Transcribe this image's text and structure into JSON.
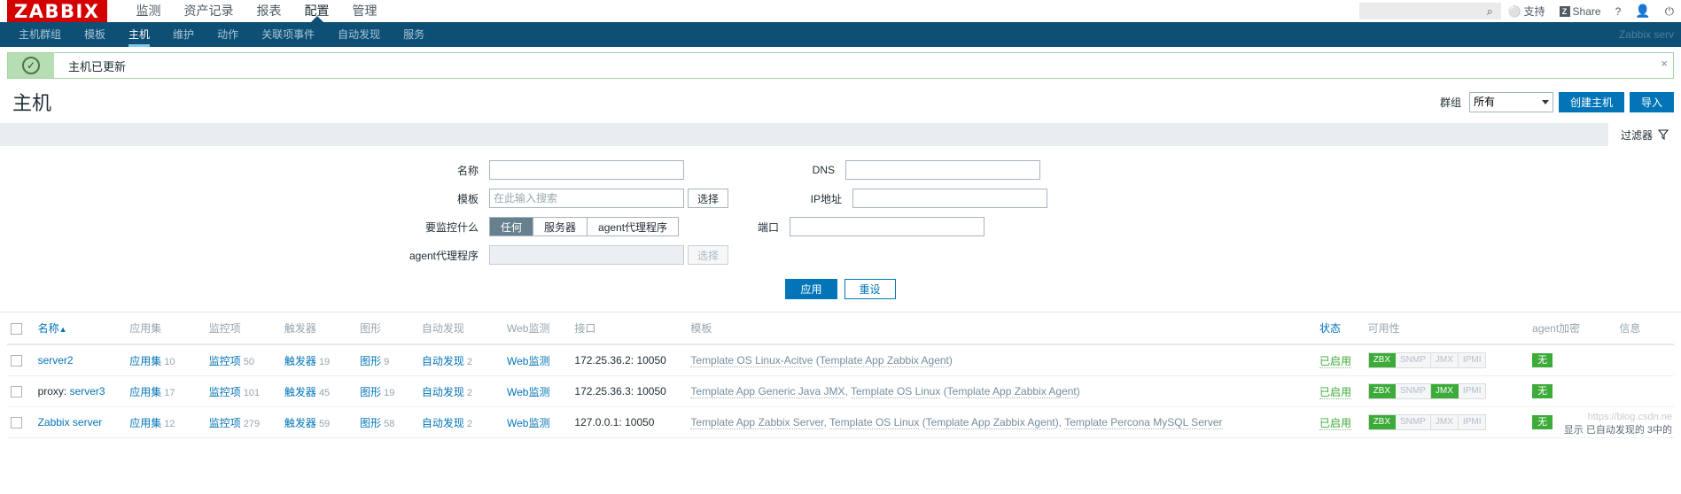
{
  "brand": {
    "logo": "ZABBIX"
  },
  "main_menu": [
    {
      "label": "监测",
      "selected": false
    },
    {
      "label": "资产记录",
      "selected": false
    },
    {
      "label": "报表",
      "selected": false
    },
    {
      "label": "配置",
      "selected": true
    },
    {
      "label": "管理",
      "selected": false
    }
  ],
  "top_right": {
    "search_placeholder": "",
    "search_value": "",
    "support_label": "支持",
    "share_label": "Share",
    "share_badge": "Z",
    "help_label": "?",
    "user_icon": "user-icon",
    "logout_icon": "power-icon"
  },
  "sub_menu": [
    {
      "label": "主机群组",
      "selected": false
    },
    {
      "label": "模板",
      "selected": false
    },
    {
      "label": "主机",
      "selected": true
    },
    {
      "label": "维护",
      "selected": false
    },
    {
      "label": "动作",
      "selected": false
    },
    {
      "label": "关联项事件",
      "selected": false
    },
    {
      "label": "自动发现",
      "selected": false
    },
    {
      "label": "服务",
      "selected": false
    }
  ],
  "server_name": "Zabbix serv",
  "message": {
    "text": "主机已更新",
    "icon": "check-circle-icon",
    "close": "×"
  },
  "page": {
    "title": "主机",
    "group_label": "群组",
    "group_value": "所有",
    "create_host_label": "创建主机",
    "import_label": "导入"
  },
  "filter_tab": {
    "label": "过滤器",
    "icon": "filter-icon"
  },
  "filter": {
    "name_label": "名称",
    "name_value": "",
    "template_label": "模板",
    "template_placeholder": "在此输入搜索",
    "template_value": "",
    "template_select_label": "选择",
    "monitored_by_label": "要监控什么",
    "monitored_by_options": [
      "任何",
      "服务器",
      "agent代理程序"
    ],
    "monitored_by_selected": "任何",
    "proxy_label": "agent代理程序",
    "proxy_value": "",
    "proxy_select_label": "选择",
    "dns_label": "DNS",
    "dns_value": "",
    "ip_label": "IP地址",
    "ip_value": "",
    "port_label": "端口",
    "port_value": "",
    "apply_label": "应用",
    "reset_label": "重设"
  },
  "table": {
    "headers": {
      "name": "名称",
      "sort_arrow": "▲",
      "applications": "应用集",
      "items": "监控项",
      "triggers": "触发器",
      "graphs": "图形",
      "discovery": "自动发现",
      "web": "Web监测",
      "interface": "接口",
      "templates": "模板",
      "status": "状态",
      "availability": "可用性",
      "encryption": "agent加密",
      "info": "信息"
    },
    "rows": [
      {
        "name": "server2",
        "name_prefix": "",
        "applications_label": "应用集",
        "applications_count": "10",
        "items_label": "监控项",
        "items_count": "50",
        "triggers_label": "触发器",
        "triggers_count": "19",
        "graphs_label": "图形",
        "graphs_count": "9",
        "discovery_label": "自动发现",
        "discovery_count": "2",
        "web_label": "Web监测",
        "interface": "172.25.36.2: 10050",
        "templates": [
          {
            "text": "Template OS Linux-Acitve",
            "link": true
          },
          {
            "text": " (",
            "link": false
          },
          {
            "text": "Template App Zabbix Agent",
            "link": true
          },
          {
            "text": ")",
            "link": false
          }
        ],
        "status": "已启用",
        "availability": [
          {
            "label": "ZBX",
            "active": true
          },
          {
            "label": "SNMP",
            "active": false
          },
          {
            "label": "JMX",
            "active": false
          },
          {
            "label": "IPMI",
            "active": false
          }
        ],
        "encryption": "无",
        "info": ""
      },
      {
        "name": "server3",
        "name_prefix": "proxy: ",
        "applications_label": "应用集",
        "applications_count": "17",
        "items_label": "监控项",
        "items_count": "101",
        "triggers_label": "触发器",
        "triggers_count": "45",
        "graphs_label": "图形",
        "graphs_count": "19",
        "discovery_label": "自动发现",
        "discovery_count": "2",
        "web_label": "Web监测",
        "interface": "172.25.36.3: 10050",
        "templates": [
          {
            "text": "Template App Generic Java JMX",
            "link": true
          },
          {
            "text": ", ",
            "link": false
          },
          {
            "text": "Template OS Linux",
            "link": true
          },
          {
            "text": " (",
            "link": false
          },
          {
            "text": "Template App Zabbix Agent",
            "link": true
          },
          {
            "text": ")",
            "link": false
          }
        ],
        "status": "已启用",
        "availability": [
          {
            "label": "ZBX",
            "active": true
          },
          {
            "label": "SNMP",
            "active": false
          },
          {
            "label": "JMX",
            "active": true
          },
          {
            "label": "IPMI",
            "active": false
          }
        ],
        "encryption": "无",
        "info": ""
      },
      {
        "name": "Zabbix server",
        "name_prefix": "",
        "applications_label": "应用集",
        "applications_count": "12",
        "items_label": "监控项",
        "items_count": "279",
        "triggers_label": "触发器",
        "triggers_count": "59",
        "graphs_label": "图形",
        "graphs_count": "58",
        "discovery_label": "自动发现",
        "discovery_count": "2",
        "web_label": "Web监测",
        "interface": "127.0.0.1: 10050",
        "templates": [
          {
            "text": "Template App Zabbix Server",
            "link": true
          },
          {
            "text": ", ",
            "link": false
          },
          {
            "text": "Template OS Linux",
            "link": true
          },
          {
            "text": " (",
            "link": false
          },
          {
            "text": "Template App Zabbix Agent",
            "link": true
          },
          {
            "text": "), ",
            "link": false
          },
          {
            "text": "Template Percona MySQL Server",
            "link": true
          }
        ],
        "status": "已启用",
        "availability": [
          {
            "label": "ZBX",
            "active": true
          },
          {
            "label": "SNMP",
            "active": false
          },
          {
            "label": "JMX",
            "active": false
          },
          {
            "label": "IPMI",
            "active": false
          }
        ],
        "encryption": "无",
        "info": ""
      }
    ]
  },
  "footer": {
    "watermark": "https://blog.csdn.ne",
    "hint": "显示 已自动发现的 3中的"
  }
}
